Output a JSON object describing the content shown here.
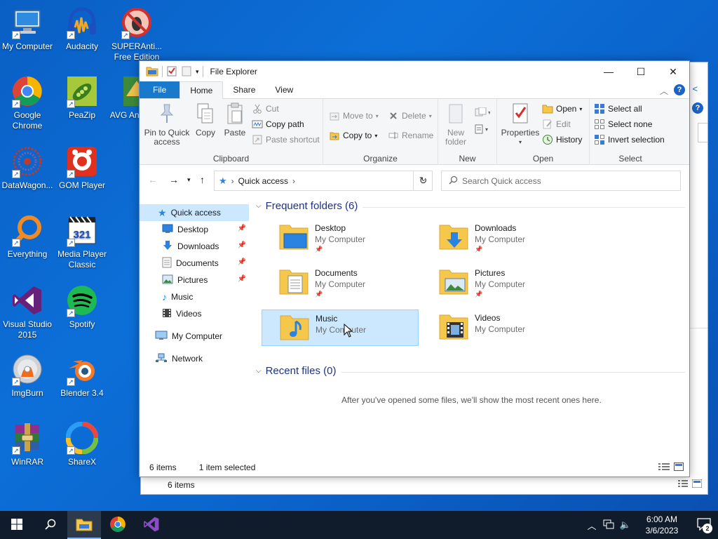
{
  "desktop": {
    "icons": [
      {
        "label": "My Computer",
        "icon": "monitor-icon"
      },
      {
        "label": "Audacity",
        "icon": "audacity-icon"
      },
      {
        "label": "SUPERAnti... Free Edition",
        "icon": "superantispyware-icon"
      },
      {
        "label": "Google Chrome",
        "icon": "chrome-icon"
      },
      {
        "label": "PeaZip",
        "icon": "peazip-icon"
      },
      {
        "label": "AVG Ant... Fre",
        "icon": "avg-icon"
      },
      {
        "label": "DataWagon...",
        "icon": "datawagon-icon"
      },
      {
        "label": "GOM Player",
        "icon": "gom-player-icon"
      },
      {
        "label": "Everything",
        "icon": "everything-icon"
      },
      {
        "label": "Media Player Classic",
        "icon": "mpc-icon"
      },
      {
        "label": "Visual Studio 2015",
        "icon": "visual-studio-icon"
      },
      {
        "label": "Spotify",
        "icon": "spotify-icon"
      },
      {
        "label": "ImgBurn",
        "icon": "imgburn-icon"
      },
      {
        "label": "Blender 3.4",
        "icon": "blender-icon"
      },
      {
        "label": "WinRAR",
        "icon": "winrar-icon"
      },
      {
        "label": "ShareX",
        "icon": "sharex-icon"
      }
    ]
  },
  "window": {
    "title": "File Explorer",
    "controls": {
      "minimize": "—",
      "maximize": "☐",
      "close": "✕"
    },
    "tabs": [
      {
        "label": "File",
        "kind": "file"
      },
      {
        "label": "Home",
        "kind": "active"
      },
      {
        "label": "Share",
        "kind": ""
      },
      {
        "label": "View",
        "kind": ""
      }
    ],
    "ribbon": {
      "clipboard": {
        "label": "Clipboard",
        "pin": "Pin to Quick access",
        "pin_l1": "Pin to Quick",
        "pin_l2": "access",
        "copy": "Copy",
        "paste": "Paste",
        "cut": "Cut",
        "copy_path": "Copy path",
        "paste_shortcut": "Paste shortcut"
      },
      "organize": {
        "label": "Organize",
        "move_to": "Move to",
        "copy_to": "Copy to",
        "delete": "Delete",
        "rename": "Rename"
      },
      "new": {
        "label": "New",
        "new_folder_l1": "New",
        "new_folder_l2": "folder"
      },
      "open": {
        "label": "Open",
        "properties": "Properties",
        "open": "Open",
        "edit": "Edit",
        "history": "History"
      },
      "select": {
        "label": "Select",
        "select_all": "Select all",
        "select_none": "Select none",
        "invert": "Invert selection"
      }
    },
    "address": {
      "crumb": "Quick access",
      "search_placeholder": "Search Quick access"
    },
    "nav": [
      {
        "label": "Quick access",
        "icon": "star-icon",
        "pinned": false
      },
      {
        "label": "Desktop",
        "icon": "desktop-icon",
        "pinned": true
      },
      {
        "label": "Downloads",
        "icon": "download-icon",
        "pinned": true
      },
      {
        "label": "Documents",
        "icon": "document-icon",
        "pinned": true
      },
      {
        "label": "Pictures",
        "icon": "pictures-icon",
        "pinned": true
      },
      {
        "label": "Music",
        "icon": "music-icon",
        "pinned": false
      },
      {
        "label": "Videos",
        "icon": "video-icon",
        "pinned": false
      },
      {
        "label": "My Computer",
        "icon": "computer-icon",
        "pinned": false
      },
      {
        "label": "Network",
        "icon": "network-icon",
        "pinned": false
      }
    ],
    "frequent": {
      "heading": "Frequent folders (6)",
      "folders": [
        {
          "name": "Desktop",
          "location": "My Computer",
          "pinned": true,
          "icon": "desktop-folder-icon"
        },
        {
          "name": "Downloads",
          "location": "My Computer",
          "pinned": true,
          "icon": "downloads-folder-icon"
        },
        {
          "name": "Documents",
          "location": "My Computer",
          "pinned": true,
          "icon": "documents-folder-icon"
        },
        {
          "name": "Pictures",
          "location": "My Computer",
          "pinned": true,
          "icon": "pictures-folder-icon"
        },
        {
          "name": "Music",
          "location": "My Computer",
          "pinned": false,
          "icon": "music-folder-icon",
          "selected": true
        },
        {
          "name": "Videos",
          "location": "My Computer",
          "pinned": false,
          "icon": "videos-folder-icon"
        }
      ]
    },
    "recent": {
      "heading": "Recent files (0)",
      "empty_message": "After you've opened some files, we'll show the most recent ones here."
    },
    "status": {
      "count": "6 items",
      "selected": "1 item selected"
    }
  },
  "background_window": {
    "status": "6 items"
  },
  "taskbar": {
    "clock_time": "6:00 AM",
    "clock_date": "3/6/2023",
    "notification_count": "2"
  },
  "colors": {
    "accent": "#1979ca",
    "selection": "#cce8ff",
    "heading": "#1e3287",
    "taskbar": "#101c2b"
  }
}
